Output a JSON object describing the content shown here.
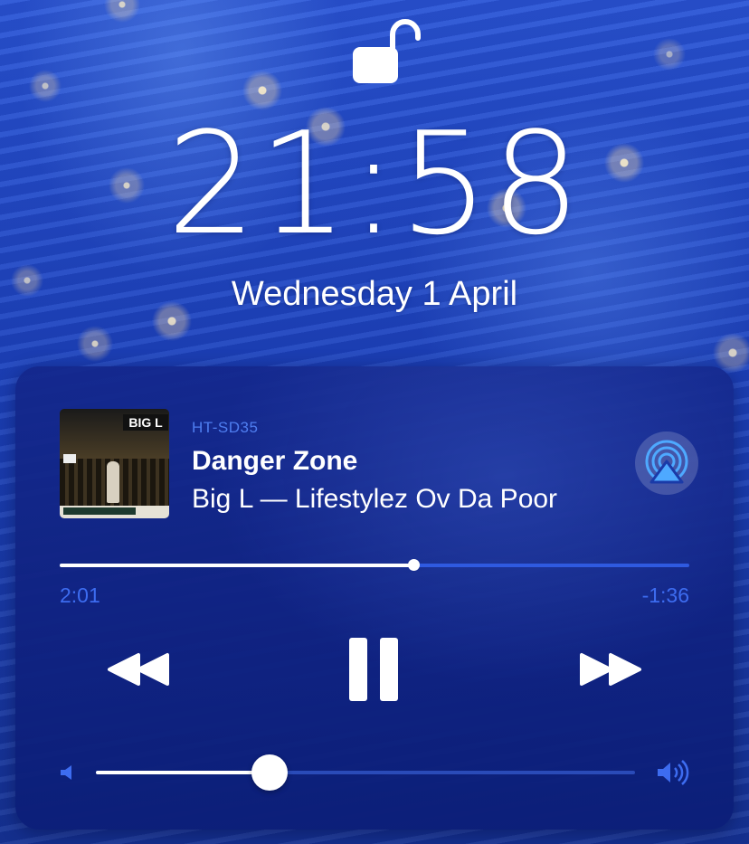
{
  "lock_screen": {
    "time": "21:58",
    "date": "Wednesday 1 April",
    "lock_icon": "unlocked-padlock-icon"
  },
  "now_playing": {
    "device": "HT-SD35",
    "title": "Danger Zone",
    "subtitle": "Big L — Lifestylez Ov Da Poor",
    "artwork_logo": "BIG L",
    "elapsed": "2:01",
    "remaining": "-1:36",
    "progress_fraction": 0.562,
    "volume_fraction": 0.322,
    "icons": {
      "airplay": "airplay-icon",
      "rewind": "rewind-icon",
      "pause": "pause-icon",
      "forward": "fast-forward-icon",
      "volume_min": "speaker-low-icon",
      "volume_max": "speaker-high-icon"
    },
    "colors": {
      "accent": "#3d6cf0",
      "track_unplayed": "#2f5ae0",
      "airplay_active": "#4ea9ff"
    }
  }
}
